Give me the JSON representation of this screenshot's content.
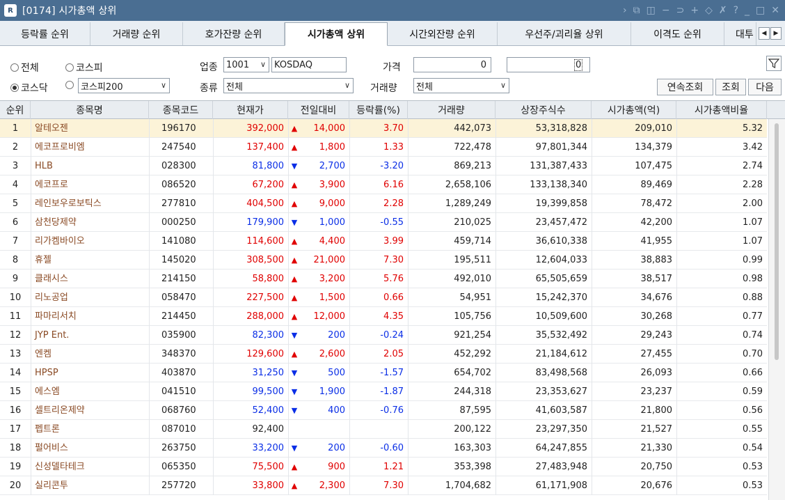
{
  "window": {
    "title": "[0174] 시가총액 상위",
    "toolbar_icons": [
      "arrow-right-icon",
      "screen-icon",
      "split-icon",
      "minus-icon",
      "link-icon",
      "plus-icon",
      "pin-icon",
      "tool-icon",
      "help-icon",
      "minimize-icon",
      "maximize-icon",
      "close-icon"
    ]
  },
  "tabs": [
    {
      "label": "등락률 순위"
    },
    {
      "label": "거래량 순위"
    },
    {
      "label": "호가잔량 순위"
    },
    {
      "label": "시가총액 상위",
      "active": true
    },
    {
      "label": "시간외잔량 순위"
    },
    {
      "label": "우선주/괴리율 상위"
    },
    {
      "label": "이격도 순위"
    },
    {
      "label": "대투"
    }
  ],
  "filters": {
    "market_all": "전체",
    "market_kospi": "코스피",
    "market_kosdaq": "코스닥",
    "market_kospi200": "코스피200",
    "sector_label": "업종",
    "sector_code": "1001",
    "sector_name": "KOSDAQ",
    "price_label": "가격",
    "price_from": "0",
    "price_to": "0",
    "type_label": "종류",
    "type_value": "전체",
    "volume_label": "거래량",
    "volume_value": "전체",
    "btn_continuous": "연속조회",
    "btn_query": "조회",
    "btn_next": "다음"
  },
  "table": {
    "headers": [
      "순위",
      "종목명",
      "종목코드",
      "현재가",
      "전일대비",
      "등락률(%)",
      "거래량",
      "상장주식수",
      "시가총액(억)",
      "시가총액비율"
    ],
    "rows": [
      {
        "rank": "1",
        "name": "알테오젠",
        "code": "196170",
        "price": "392,000",
        "dir": "up",
        "arrow": "▲",
        "change": "14,000",
        "rate": "3.70",
        "volume": "442,073",
        "shares": "53,318,828",
        "mcap": "209,010",
        "ratio": "5.32"
      },
      {
        "rank": "2",
        "name": "에코프로비엠",
        "code": "247540",
        "price": "137,400",
        "dir": "up",
        "arrow": "▲",
        "change": "1,800",
        "rate": "1.33",
        "volume": "722,478",
        "shares": "97,801,344",
        "mcap": "134,379",
        "ratio": "3.42"
      },
      {
        "rank": "3",
        "name": "HLB",
        "code": "028300",
        "price": "81,800",
        "dir": "down",
        "arrow": "▼",
        "change": "2,700",
        "rate": "-3.20",
        "volume": "869,213",
        "shares": "131,387,433",
        "mcap": "107,475",
        "ratio": "2.74"
      },
      {
        "rank": "4",
        "name": "에코프로",
        "code": "086520",
        "price": "67,200",
        "dir": "up",
        "arrow": "▲",
        "change": "3,900",
        "rate": "6.16",
        "volume": "2,658,106",
        "shares": "133,138,340",
        "mcap": "89,469",
        "ratio": "2.28"
      },
      {
        "rank": "5",
        "name": "레인보우로보틱스",
        "code": "277810",
        "price": "404,500",
        "dir": "up",
        "arrow": "▲",
        "change": "9,000",
        "rate": "2.28",
        "volume": "1,289,249",
        "shares": "19,399,858",
        "mcap": "78,472",
        "ratio": "2.00"
      },
      {
        "rank": "6",
        "name": "삼천당제약",
        "code": "000250",
        "price": "179,900",
        "dir": "down",
        "arrow": "▼",
        "change": "1,000",
        "rate": "-0.55",
        "volume": "210,025",
        "shares": "23,457,472",
        "mcap": "42,200",
        "ratio": "1.07"
      },
      {
        "rank": "7",
        "name": "리가켐바이오",
        "code": "141080",
        "price": "114,600",
        "dir": "up",
        "arrow": "▲",
        "change": "4,400",
        "rate": "3.99",
        "volume": "459,714",
        "shares": "36,610,338",
        "mcap": "41,955",
        "ratio": "1.07"
      },
      {
        "rank": "8",
        "name": "휴젤",
        "code": "145020",
        "price": "308,500",
        "dir": "up",
        "arrow": "▲",
        "change": "21,000",
        "rate": "7.30",
        "volume": "195,511",
        "shares": "12,604,033",
        "mcap": "38,883",
        "ratio": "0.99"
      },
      {
        "rank": "9",
        "name": "클래시스",
        "code": "214150",
        "price": "58,800",
        "dir": "up",
        "arrow": "▲",
        "change": "3,200",
        "rate": "5.76",
        "volume": "492,010",
        "shares": "65,505,659",
        "mcap": "38,517",
        "ratio": "0.98"
      },
      {
        "rank": "10",
        "name": "리노공업",
        "code": "058470",
        "price": "227,500",
        "dir": "up",
        "arrow": "▲",
        "change": "1,500",
        "rate": "0.66",
        "volume": "54,951",
        "shares": "15,242,370",
        "mcap": "34,676",
        "ratio": "0.88"
      },
      {
        "rank": "11",
        "name": "파마리서치",
        "code": "214450",
        "price": "288,000",
        "dir": "up",
        "arrow": "▲",
        "change": "12,000",
        "rate": "4.35",
        "volume": "105,756",
        "shares": "10,509,600",
        "mcap": "30,268",
        "ratio": "0.77"
      },
      {
        "rank": "12",
        "name": "JYP Ent.",
        "code": "035900",
        "price": "82,300",
        "dir": "down",
        "arrow": "▼",
        "change": "200",
        "rate": "-0.24",
        "volume": "921,254",
        "shares": "35,532,492",
        "mcap": "29,243",
        "ratio": "0.74"
      },
      {
        "rank": "13",
        "name": "엔켐",
        "code": "348370",
        "price": "129,600",
        "dir": "up",
        "arrow": "▲",
        "change": "2,600",
        "rate": "2.05",
        "volume": "452,292",
        "shares": "21,184,612",
        "mcap": "27,455",
        "ratio": "0.70"
      },
      {
        "rank": "14",
        "name": "HPSP",
        "code": "403870",
        "price": "31,250",
        "dir": "down",
        "arrow": "▼",
        "change": "500",
        "rate": "-1.57",
        "volume": "654,702",
        "shares": "83,498,568",
        "mcap": "26,093",
        "ratio": "0.66"
      },
      {
        "rank": "15",
        "name": "에스엠",
        "code": "041510",
        "price": "99,500",
        "dir": "down",
        "arrow": "▼",
        "change": "1,900",
        "rate": "-1.87",
        "volume": "244,318",
        "shares": "23,353,627",
        "mcap": "23,237",
        "ratio": "0.59"
      },
      {
        "rank": "16",
        "name": "셀트리온제약",
        "code": "068760",
        "price": "52,400",
        "dir": "down",
        "arrow": "▼",
        "change": "400",
        "rate": "-0.76",
        "volume": "87,595",
        "shares": "41,603,587",
        "mcap": "21,800",
        "ratio": "0.56"
      },
      {
        "rank": "17",
        "name": "펩트론",
        "code": "087010",
        "price": "92,400",
        "dir": "flat",
        "arrow": "",
        "change": "",
        "rate": "",
        "volume": "200,122",
        "shares": "23,297,350",
        "mcap": "21,527",
        "ratio": "0.55"
      },
      {
        "rank": "18",
        "name": "펄어비스",
        "code": "263750",
        "price": "33,200",
        "dir": "down",
        "arrow": "▼",
        "change": "200",
        "rate": "-0.60",
        "volume": "163,303",
        "shares": "64,247,855",
        "mcap": "21,330",
        "ratio": "0.54"
      },
      {
        "rank": "19",
        "name": "신성델타테크",
        "code": "065350",
        "price": "75,500",
        "dir": "up",
        "arrow": "▲",
        "change": "900",
        "rate": "1.21",
        "volume": "353,398",
        "shares": "27,483,948",
        "mcap": "20,750",
        "ratio": "0.53"
      },
      {
        "rank": "20",
        "name": "실리콘투",
        "code": "257720",
        "price": "33,800",
        "dir": "up",
        "arrow": "▲",
        "change": "2,300",
        "rate": "7.30",
        "volume": "1,704,682",
        "shares": "61,171,908",
        "mcap": "20,676",
        "ratio": "0.53"
      }
    ]
  },
  "colors": {
    "titlebar": "#4a6e92",
    "up": "#e00000",
    "down": "#0a2ee6",
    "stock_name": "#8a4a24",
    "selected_row": "#fcf3d8"
  }
}
